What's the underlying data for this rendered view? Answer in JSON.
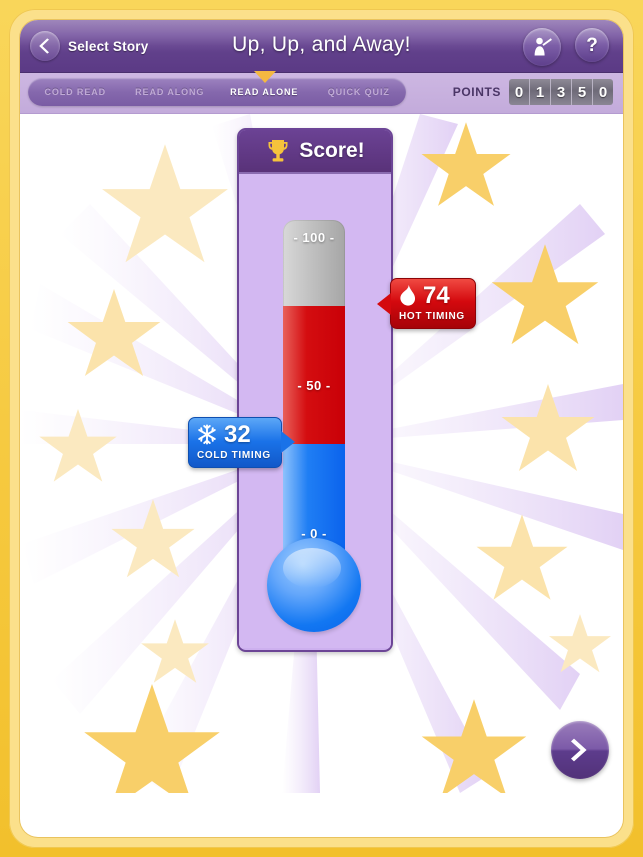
{
  "header": {
    "back_label": "Select Story",
    "back_icon": "chevron-left-icon",
    "title": "Up, Up, and Away!",
    "teacher_icon": "teacher-pointer-icon",
    "help_label": "?"
  },
  "tabs": {
    "items": [
      {
        "label": "COLD READ",
        "active": false
      },
      {
        "label": "READ ALONG",
        "active": false
      },
      {
        "label": "READ ALONE",
        "active": true
      },
      {
        "label": "QUICK QUIZ",
        "active": false
      }
    ],
    "marker_icon": "triangle-down-marker"
  },
  "points": {
    "label": "POINTS",
    "digits": [
      "0",
      "1",
      "3",
      "5",
      "0"
    ]
  },
  "score_panel": {
    "trophy_icon": "trophy-icon",
    "title": "Score!"
  },
  "thermometer": {
    "tick_top": "- 100 -",
    "tick_mid": "- 50 -",
    "tick_bottom": "- 0 -",
    "scale_min": 0,
    "scale_max": 100,
    "hot_value": 74,
    "cold_value": 32,
    "gray_color": "#b5b5b5",
    "red_color": "#d40d10",
    "blue_color": "#1f7ef4"
  },
  "badges": {
    "hot": {
      "value": "74",
      "caption": "HOT TIMING",
      "icon": "flame-icon",
      "color": "#d4090e"
    },
    "cold": {
      "value": "32",
      "caption": "COLD TIMING",
      "icon": "snowflake-icon",
      "color": "#1a72e8"
    }
  },
  "next_button": {
    "icon": "chevron-right-icon"
  },
  "theme": {
    "frame_gold": "#f6c93f",
    "bar_purple": "#61408b",
    "panel_lavender": "#d3b8f2",
    "accent_yellow": "#f4b841"
  }
}
